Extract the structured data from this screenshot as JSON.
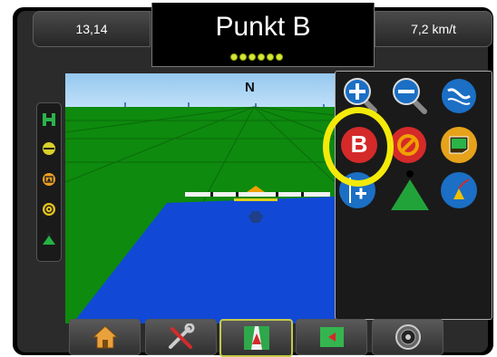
{
  "header": {
    "left_value": "13,14",
    "title": "Punkt B",
    "speed": "7,2 km/t",
    "signal_dots": 6
  },
  "field_view": {
    "compass": "N"
  },
  "tools_panel": {
    "items": [
      {
        "icon": "zoom-in-icon",
        "color": "#1b6fc4"
      },
      {
        "icon": "zoom-out-icon",
        "color": "#1b6fc4"
      },
      {
        "icon": "guidance-mode-icon",
        "color": "#1b6fc4"
      },
      {
        "icon": "mark-b-icon",
        "color": "#d42a2a",
        "label": "B"
      },
      {
        "icon": "cancel-icon",
        "color": "#d42a2a"
      },
      {
        "icon": "boundary-icon",
        "color": "#e6a21a"
      },
      {
        "icon": "nudge-icon",
        "color": "#1b6fc4"
      },
      {
        "icon": "vehicle-view-icon",
        "color": "#22a33a"
      },
      {
        "icon": "perspective-icon",
        "color": "#1b6fc4"
      }
    ],
    "highlight_color": "#f4ea0a"
  },
  "bottom_nav": [
    {
      "icon": "home-icon"
    },
    {
      "icon": "tools-icon"
    },
    {
      "icon": "guidance-icon",
      "active": true
    },
    {
      "icon": "field-map-icon"
    },
    {
      "icon": "gauge-icon"
    }
  ]
}
